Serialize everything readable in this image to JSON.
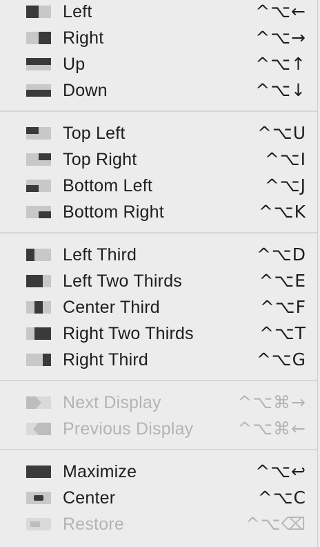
{
  "menu": {
    "groups": [
      {
        "items": [
          {
            "label": "Left",
            "shortcut": "^⌥←",
            "icon": "left-half-icon",
            "enabled": true
          },
          {
            "label": "Right",
            "shortcut": "^⌥→",
            "icon": "right-half-icon",
            "enabled": true
          },
          {
            "label": "Up",
            "shortcut": "^⌥↑",
            "icon": "top-half-icon",
            "enabled": true
          },
          {
            "label": "Down",
            "shortcut": "^⌥↓",
            "icon": "bottom-half-icon",
            "enabled": true
          }
        ]
      },
      {
        "items": [
          {
            "label": "Top Left",
            "shortcut": "^⌥U",
            "icon": "top-left-quarter-icon",
            "enabled": true
          },
          {
            "label": "Top Right",
            "shortcut": "^⌥I",
            "icon": "top-right-quarter-icon",
            "enabled": true
          },
          {
            "label": "Bottom Left",
            "shortcut": "^⌥J",
            "icon": "bottom-left-quarter-icon",
            "enabled": true
          },
          {
            "label": "Bottom Right",
            "shortcut": "^⌥K",
            "icon": "bottom-right-quarter-icon",
            "enabled": true
          }
        ]
      },
      {
        "items": [
          {
            "label": "Left Third",
            "shortcut": "^⌥D",
            "icon": "left-third-icon",
            "enabled": true
          },
          {
            "label": "Left Two Thirds",
            "shortcut": "^⌥E",
            "icon": "left-two-thirds-icon",
            "enabled": true
          },
          {
            "label": "Center Third",
            "shortcut": "^⌥F",
            "icon": "center-third-icon",
            "enabled": true
          },
          {
            "label": "Right Two Thirds",
            "shortcut": "^⌥T",
            "icon": "right-two-thirds-icon",
            "enabled": true
          },
          {
            "label": "Right Third",
            "shortcut": "^⌥G",
            "icon": "right-third-icon",
            "enabled": true
          }
        ]
      },
      {
        "items": [
          {
            "label": "Next Display",
            "shortcut": "^⌥⌘→",
            "icon": "next-display-icon",
            "enabled": false
          },
          {
            "label": "Previous Display",
            "shortcut": "^⌥⌘←",
            "icon": "previous-display-icon",
            "enabled": false
          }
        ]
      },
      {
        "items": [
          {
            "label": "Maximize",
            "shortcut": "^⌥↩",
            "icon": "maximize-icon",
            "enabled": true
          },
          {
            "label": "Center",
            "shortcut": "^⌥C",
            "icon": "center-icon",
            "enabled": true
          },
          {
            "label": "Restore",
            "shortcut": "^⌥⌫",
            "icon": "restore-icon",
            "enabled": false
          }
        ]
      }
    ]
  },
  "colors": {
    "menu_background": "#ececec",
    "text": "#1e1e1e",
    "disabled_text": "#b4b4b4",
    "icon_dark": "#3a3a3a",
    "icon_light": "#c8c8c8",
    "icon_disabled_dark": "#bdbdbd",
    "icon_disabled_light": "#dadada"
  }
}
